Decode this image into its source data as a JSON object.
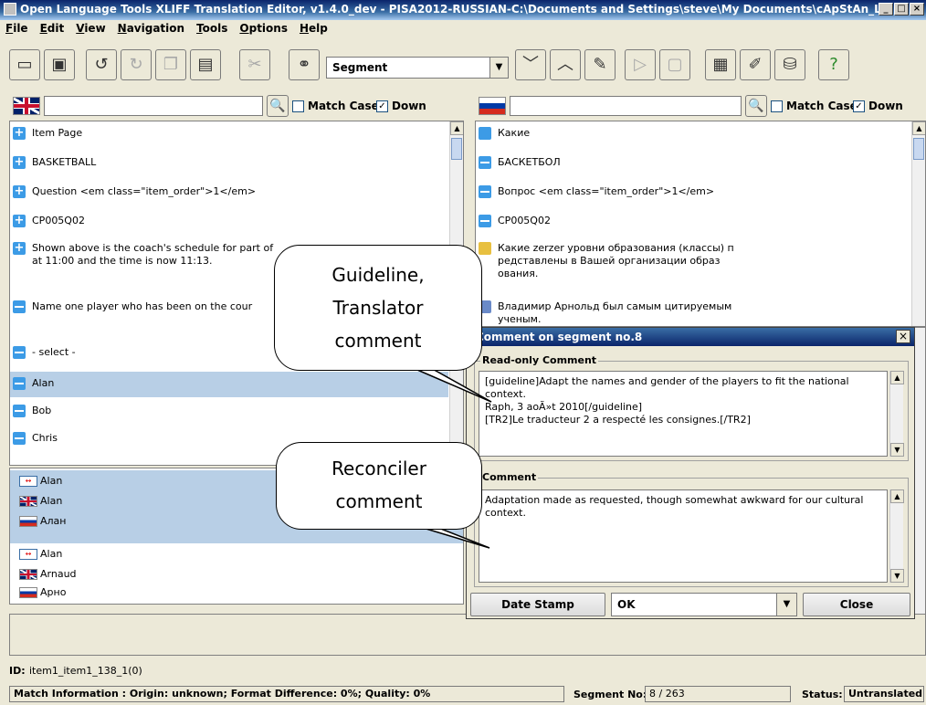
{
  "window": {
    "title": "Open Language Tools XLIFF Translation Editor, v1.4.0_dev - PISA2012-RUSSIAN-C:\\Documents and Settings\\steve\\My Documents\\cApStAn_Loca",
    "min_label": "_",
    "max_label": "□",
    "close_label": "×"
  },
  "menu": [
    "File",
    "Edit",
    "View",
    "Navigation",
    "Tools",
    "Options",
    "Help"
  ],
  "toolbar": {
    "segment_select": "Segment",
    "icons": [
      "open-folder-icon",
      "save-icon",
      "undo-icon",
      "redo-icon",
      "copy-icon",
      "paste-icon",
      "cut-icon",
      "binoculars-icon",
      "down-chevron-icon",
      "up-chevron-icon",
      "edit-note-icon",
      "copy-source-icon",
      "clear-icon",
      "grid-icon",
      "pen-icon",
      "database-icon",
      "help-icon"
    ]
  },
  "source_pane": {
    "match_case": "Match Case",
    "down": "Down",
    "segments": [
      {
        "type": "plus",
        "text": "Item Page"
      },
      {
        "type": "plus",
        "text": "BASKETBALL"
      },
      {
        "type": "plus",
        "text": "Question <em class=\"item_order\">1</em>"
      },
      {
        "type": "plus",
        "text": "CP005Q02"
      },
      {
        "type": "plus",
        "text": "Shown above is the coach's schedule for part of\nat 11:00 and the time is now 11:13."
      },
      {
        "type": "minus",
        "text": "Name one player who has been on the cour"
      },
      {
        "type": "minus",
        "text": "- select -"
      },
      {
        "type": "minus",
        "text": "Alan"
      },
      {
        "type": "minus",
        "text": "Bob"
      },
      {
        "type": "minus",
        "text": "Chris"
      }
    ]
  },
  "target_pane": {
    "match_case": "Match Case",
    "down": "Down",
    "segments": [
      {
        "text": "Какие"
      },
      {
        "text": "БАСКЕТБОЛ"
      },
      {
        "text": "Вопрос <em class=\"item_order\">1</em>"
      },
      {
        "text": "CP005Q02"
      },
      {
        "text": "Какие zerzer уровни образования (классы) п\nредставлены в Вашей организации образ\nования."
      },
      {
        "text": "Владимир Арнольд был самым цитируемым\nученым."
      }
    ]
  },
  "matches": [
    {
      "flag": "src",
      "text": "Alan"
    },
    {
      "flag": "uk",
      "text": "Alan"
    },
    {
      "flag": "ru",
      "text": "Алан"
    },
    {
      "flag": "src",
      "text": "Alan"
    },
    {
      "flag": "uk",
      "text": "Arnaud"
    },
    {
      "flag": "ru",
      "text": "Арно"
    }
  ],
  "bubbles": {
    "translator": "Guideline,\nTranslator\ncomment",
    "reconciler": "Reconciler\ncomment"
  },
  "dialog": {
    "title": "Comment on segment no.8",
    "readonly_label": "Read-only Comment",
    "readonly_text": "[guideline]Adapt the names and gender of the players to fit the national context.\nRaph, 3 aoÃ»t 2010[/guideline]\n[TR2]Le traducteur 2 a respecté les consignes.[/TR2]",
    "comment_label": "Comment",
    "comment_text": "Adaptation made as requested, though somewhat awkward for our cultural context.",
    "date_stamp": "Date Stamp",
    "ok": "OK",
    "close": "Close"
  },
  "id_bar": {
    "label": "ID:",
    "value": "item1_item1_138_1(0)"
  },
  "status": {
    "match_info": "Match Information : Origin: unknown; Format Difference: 0%; Quality: 0%",
    "segment_label": "Segment No:",
    "segment_value": "8 / 263",
    "status_label": "Status:",
    "status_value": "Untranslated"
  }
}
